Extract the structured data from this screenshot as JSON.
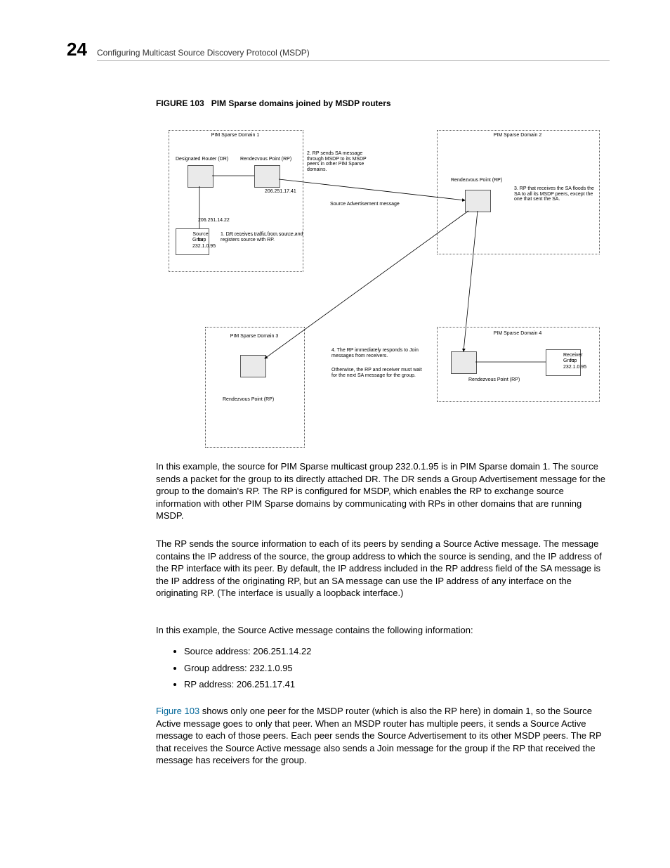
{
  "header": {
    "page_number": "24",
    "title": "Configuring Multicast Source Discovery Protocol (MSDP)"
  },
  "figure": {
    "caption_label": "FIGURE 103",
    "caption_text": "PIM Sparse domains joined by MSDP routers",
    "domain1": "PIM Sparse Domain 1",
    "domain2": "PIM Sparse Domain 2",
    "domain3": "PIM Sparse Domain 3",
    "domain4": "PIM Sparse Domain 4",
    "dr_label": "Designated Router (DR)",
    "rp_label": "Rendezvous Point (RP)",
    "rp_label2": "Rendezvous Point (RP)",
    "rp_label3": "Rendezvous Point (RP)",
    "rp_label4": "Rendezvous Point (RP)",
    "ip_rp": "206.251.17.41",
    "ip_dr": "206.251.14.22",
    "src_box_l1": "Source for",
    "src_box_l2": "Group",
    "src_box_l3": "232.1.0.95",
    "rcv_box_l1": "Receiver for",
    "rcv_box_l2": "Group",
    "rcv_box_l3": "232.1.0.95",
    "note1": "1.  DR receives traffic from source and registers source with RP.",
    "note2": "2.  RP sends SA message through MSDP to its MSDP peers in other PIM Sparse domains.",
    "note3": "3.  RP that receives the SA floods the SA to all its MSDP peers, except the one that sent the SA.",
    "note4a": "4. The RP immediately responds to Join messages from receivers.",
    "note4b": "Otherwise, the RP and  receiver must wait for the next SA message for the group.",
    "sa_msg": "Source Advertisement message"
  },
  "body": {
    "p1": "In this example, the source for PIM Sparse multicast group 232.0.1.95 is in PIM Sparse domain 1. The source sends a packet for the group to its directly attached DR. The DR sends a Group Advertisement message for the group to the domain's RP. The RP is configured for MSDP, which enables the RP to exchange source information with other PIM Sparse domains by communicating with RPs in other domains that are running MSDP.",
    "p2": "The RP sends the source information to each of its peers by sending a Source Active message. The message contains the IP address of the source, the group address to which the source is sending, and the IP address of the RP interface with its peer. By default, the IP address included in the RP address field of the SA message is the IP address of the originating RP, but an SA message can use the IP address of any interface on the originating RP.   (The interface is usually a loopback interface.)",
    "p3": "In this example, the Source Active message contains the following information:",
    "li1": "Source address: 206.251.14.22",
    "li2": "Group address: 232.1.0.95",
    "li3": "RP address: 206.251.17.41",
    "p4_link": "Figure 103",
    "p4_rest": " shows only one peer for the MSDP router (which is also the RP here) in domain 1, so the Source Active message goes to only that peer. When an MSDP router has multiple peers, it sends a Source Active message to each of those peers. Each peer sends the Source Advertisement to its other MSDP peers. The RP that receives the Source Active message also sends a Join message for the group if the RP that received the message has receivers for the group."
  }
}
